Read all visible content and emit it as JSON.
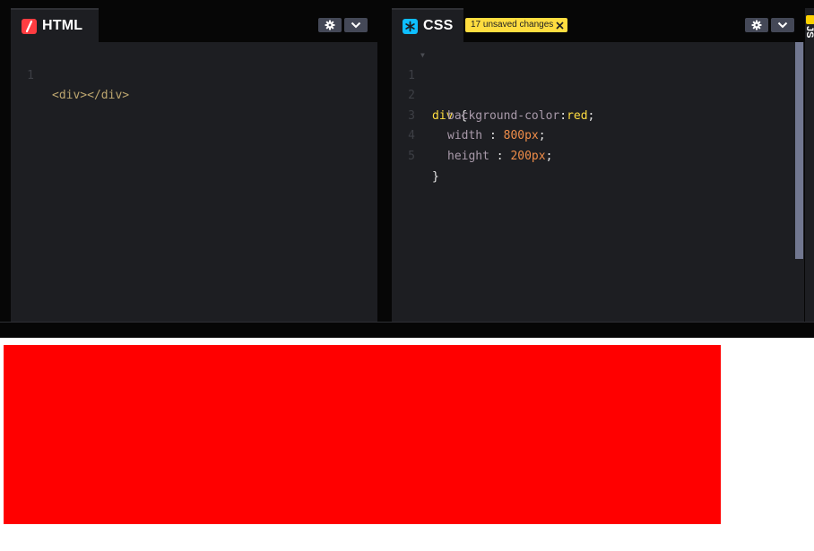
{
  "html_panel": {
    "title": "HTML",
    "icon": "html-logo-icon",
    "icon_color": "#ff3c41",
    "lines": [
      {
        "num": "1",
        "text": "<div></div>"
      }
    ]
  },
  "css_panel": {
    "title": "CSS",
    "icon": "css-logo-icon",
    "icon_color": "#0ebeff",
    "badge": "17 unsaved changes",
    "line_numbers": [
      "1",
      "2",
      "3",
      "4",
      "5"
    ],
    "tokens": {
      "l1_selector": "div",
      "l1_brace": "{",
      "l2_prop": "background-color",
      "l2_colon": ":",
      "l2_value": "red",
      "l2_semi": ";",
      "l3_prop": "width",
      "l3_colon": " : ",
      "l3_value": "800px",
      "l3_semi": ";",
      "l4_prop": "height",
      "l4_colon": " : ",
      "l4_value": "200px",
      "l4_semi": ";",
      "l5_brace": "}"
    }
  },
  "js_panel": {
    "title_fragment": "JS"
  },
  "preview": {
    "box_color": "#ff0000"
  },
  "colors": {
    "badge_bg": "#ffdd40",
    "editor_bg": "#1d1e22",
    "header_bg": "#060606",
    "button_bg": "#444857"
  }
}
